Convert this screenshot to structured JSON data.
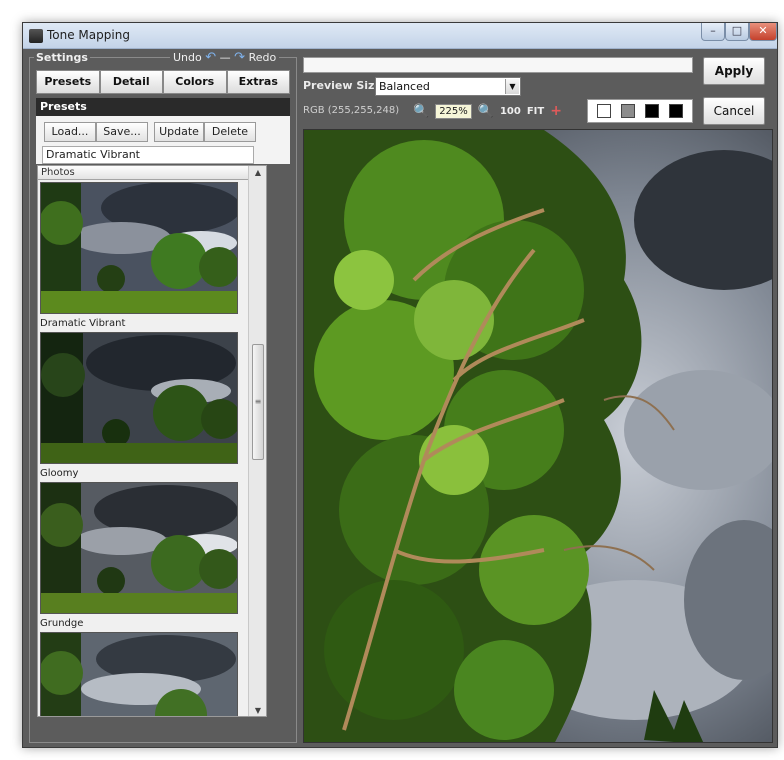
{
  "window": {
    "title": "Tone Mapping"
  },
  "settings": {
    "legend": "Settings",
    "undo_label": "Undo",
    "redo_label": "Redo"
  },
  "tabs": [
    {
      "label": "Presets"
    },
    {
      "label": "Detail"
    },
    {
      "label": "Colors"
    },
    {
      "label": "Extras"
    }
  ],
  "presets": {
    "header": "Presets",
    "load_label": "Load...",
    "save_label": "Save...",
    "update_label": "Update",
    "delete_label": "Delete",
    "current_name": "Dramatic Vibrant",
    "list_header": "Photos",
    "items": [
      {
        "label": "Dramatic Vibrant"
      },
      {
        "label": "Gloomy"
      },
      {
        "label": "Grundge"
      },
      {
        "label": ""
      }
    ]
  },
  "preview": {
    "size_label": "Preview Size",
    "size_value": "Balanced",
    "rgb_readout": "RGB (255,255,248)",
    "zoom_value": "225%",
    "zoom_100_label": "100",
    "fit_label": "FIT"
  },
  "actions": {
    "apply_label": "Apply",
    "cancel_label": "Cancel"
  },
  "icons": {
    "undo": "undo-arrow-icon",
    "redo": "redo-arrow-icon",
    "zoom_in": "zoom-in-icon",
    "zoom_out": "zoom-out-icon",
    "crosshair": "crosshair-icon"
  },
  "colors": {
    "panel_bg": "#5c5c5c",
    "title_bar": "#c3d3e8",
    "presets_header_bg": "#2a2a2a",
    "swatches": [
      "#ffffff",
      "#8c8c8c",
      "#000000",
      "#000000"
    ]
  }
}
